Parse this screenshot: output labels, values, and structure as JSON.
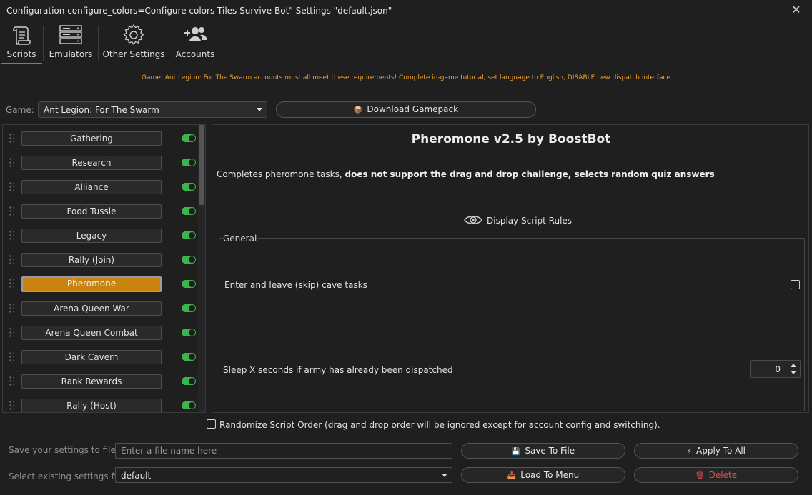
{
  "window": {
    "title": "Configuration configure_colors=Configure colors Tiles Survive Bot\" Settings \"default.json\""
  },
  "tabs": [
    {
      "label": "Scripts",
      "icon": "scroll-icon",
      "active": true
    },
    {
      "label": "Emulators",
      "icon": "server-icon",
      "active": false
    },
    {
      "label": "Other Settings",
      "icon": "gear-icon",
      "active": false
    },
    {
      "label": "Accounts",
      "icon": "users-icon",
      "active": false
    }
  ],
  "notice": "Game: Ant Legion: For The Swarm accounts must all meet these requirements! Complete in-game tutorial, set language to English, DISABLE new dispatch interface",
  "game": {
    "label": "Game:",
    "selected": "Ant Legion: For The Swarm",
    "download_button": "Download Gamepack"
  },
  "scripts": [
    {
      "label": "Gathering",
      "enabled": true,
      "active": false
    },
    {
      "label": "Research",
      "enabled": true,
      "active": false
    },
    {
      "label": "Alliance",
      "enabled": true,
      "active": false
    },
    {
      "label": "Food Tussle",
      "enabled": true,
      "active": false
    },
    {
      "label": "Legacy",
      "enabled": true,
      "active": false
    },
    {
      "label": "Rally (Join)",
      "enabled": true,
      "active": false
    },
    {
      "label": "Pheromone",
      "enabled": true,
      "active": true
    },
    {
      "label": "Arena Queen War",
      "enabled": true,
      "active": false
    },
    {
      "label": "Arena Queen Combat",
      "enabled": true,
      "active": false
    },
    {
      "label": "Dark Cavern",
      "enabled": true,
      "active": false
    },
    {
      "label": "Rank Rewards",
      "enabled": true,
      "active": false
    },
    {
      "label": "Rally (Host)",
      "enabled": true,
      "active": false
    }
  ],
  "detail": {
    "title": "Pheromone v2.5 by BoostBot",
    "desc_plain": "Completes pheromone tasks, ",
    "desc_bold": "does not support the drag and drop challenge, selects random quiz answers",
    "rules_label": "Display Script Rules",
    "group_label": "General",
    "option_cave": "Enter and leave (skip) cave tasks",
    "option_cave_checked": false,
    "option_sleep": "Sleep X seconds if army has already been dispatched",
    "option_sleep_value": "0"
  },
  "randomize": {
    "label": "Randomize Script Order (drag and drop order will be ignored except for account config and switching).",
    "checked": false
  },
  "bottom": {
    "save_label": "Save your settings to file",
    "save_placeholder": "Enter a file name here",
    "save_button": "Save To File",
    "apply_button": "Apply To All",
    "select_label": "Select existing settings file",
    "select_value": "default",
    "load_button": "Load To Menu",
    "delete_button": "Delete"
  },
  "colors": {
    "accent": "#3a8be0",
    "active_script": "#c98410",
    "toggle_on": "#3bb54a",
    "notice": "#e8a13a",
    "save_icon": "#e8a13a",
    "delete": "#e05050"
  }
}
